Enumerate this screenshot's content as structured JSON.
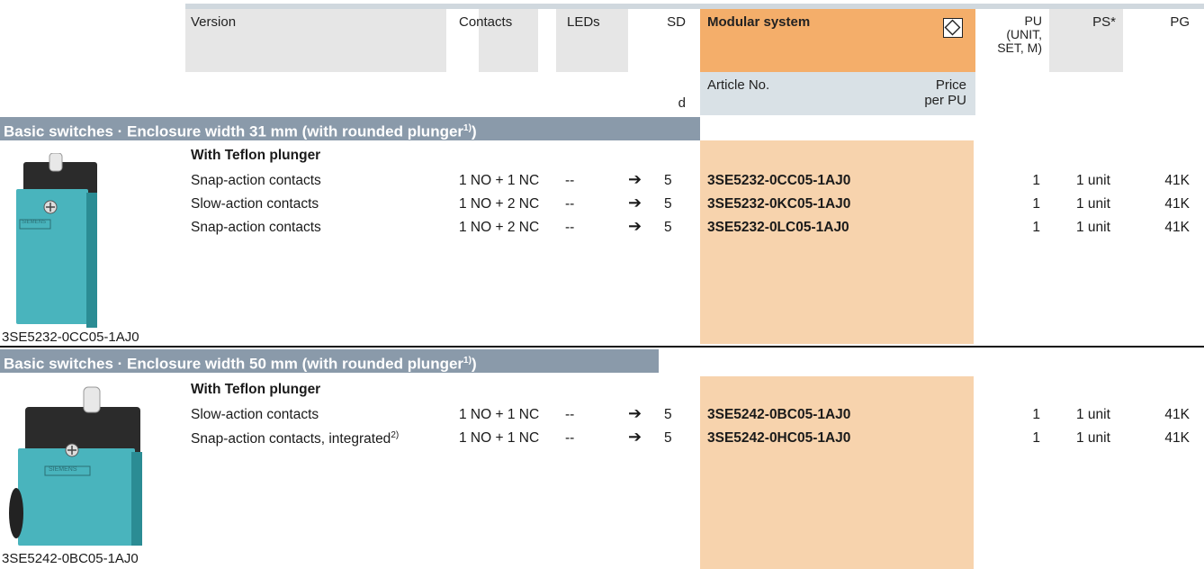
{
  "header": {
    "version": "Version",
    "contacts": "Contacts",
    "leds": "LEDs",
    "sd": "SD",
    "sd_unit": "d",
    "modular_system": "Modular system",
    "article_no": "Article No.",
    "price_line1": "Price",
    "price_line2": "per PU",
    "pu_line1": "PU",
    "pu_line2": "(UNIT,",
    "pu_line3": "SET, M)",
    "ps": "PS*",
    "pg": "PG"
  },
  "sections": [
    {
      "title": "Basic switches · Enclosure width 31 mm (with rounded plunger",
      "title_sup": "1)",
      "title_end": ")",
      "subheading": "With Teflon plunger",
      "image_caption": "3SE5232-0CC05-1AJ0",
      "rows": [
        {
          "version": "Snap-action contacts",
          "version_sup": "",
          "contacts": "1 NO + 1 NC",
          "leds": "--",
          "sd": "5",
          "article": "3SE5232-0CC05-1AJ0",
          "pu": "1",
          "ps": "1 unit",
          "pg": "41K"
        },
        {
          "version": "Slow-action contacts",
          "version_sup": "",
          "contacts": "1 NO + 2 NC",
          "leds": "--",
          "sd": "5",
          "article": "3SE5232-0KC05-1AJ0",
          "pu": "1",
          "ps": "1 unit",
          "pg": "41K"
        },
        {
          "version": "Snap-action contacts",
          "version_sup": "",
          "contacts": "1 NO + 2 NC",
          "leds": "--",
          "sd": "5",
          "article": "3SE5232-0LC05-1AJ0",
          "pu": "1",
          "ps": "1 unit",
          "pg": "41K"
        }
      ]
    },
    {
      "title": "Basic switches · Enclosure width 50 mm (with rounded plunger",
      "title_sup": "1)",
      "title_end": ")",
      "subheading": "With Teflon plunger",
      "image_caption": "3SE5242-0BC05-1AJ0",
      "rows": [
        {
          "version": "Slow-action contacts",
          "version_sup": "",
          "contacts": "1 NO + 1 NC",
          "leds": "--",
          "sd": "5",
          "article": "3SE5242-0BC05-1AJ0",
          "pu": "1",
          "ps": "1 unit",
          "pg": "41K"
        },
        {
          "version": "Snap-action contacts, integrated",
          "version_sup": "2)",
          "contacts": "1 NO + 1 NC",
          "leds": "--",
          "sd": "5",
          "article": "3SE5242-0HC05-1AJ0",
          "pu": "1",
          "ps": "1 unit",
          "pg": "41K"
        }
      ]
    }
  ],
  "logo_text": "SIEMENS",
  "icons": {
    "sd_arrow": "circled-right-arrow-icon",
    "modular": "diamond-in-square-icon"
  },
  "colors": {
    "orange": "#f4ae6a",
    "light_orange": "#f7d3ad",
    "section_bar": "#8a9aaa",
    "header_gray": "#e6e6e6",
    "product": "#3fb3b8"
  }
}
